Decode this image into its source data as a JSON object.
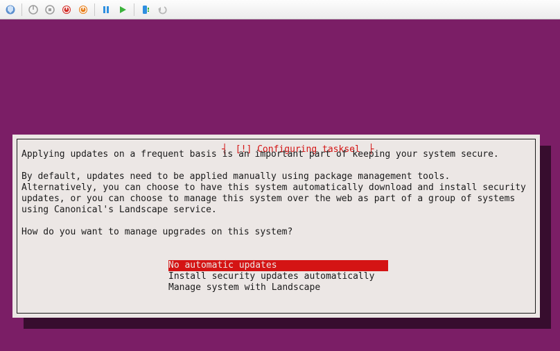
{
  "toolbar": {
    "icons": [
      "vm-manager-icon",
      "power-off-icon",
      "power-hard-off-icon",
      "shutdown-red-icon",
      "shutdown-orange-icon",
      "pause-icon",
      "play-icon",
      "usb-icon",
      "undo-icon"
    ]
  },
  "dialog": {
    "title": "[!] Configuring tasksel",
    "paragraph1": "Applying updates on a frequent basis is an important part of keeping your system secure.",
    "paragraph2": "By default, updates need to be applied manually using package management tools. Alternatively, you can choose to have this system automatically download and install security updates, or you can choose to manage this system over the web as part of a group of systems using Canonical's Landscape service.",
    "question": "How do you want to manage upgrades on this system?",
    "options": [
      {
        "label": "No automatic updates",
        "selected": true
      },
      {
        "label": "Install security updates automatically",
        "selected": false
      },
      {
        "label": "Manage system with Landscape",
        "selected": false
      }
    ],
    "selected_pad": "                    "
  },
  "colors": {
    "background": "#7b1e66",
    "panel": "#ece7e5",
    "accent": "#d41414"
  }
}
